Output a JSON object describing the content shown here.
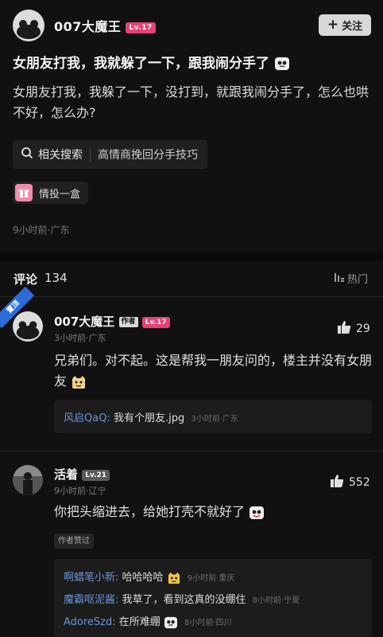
{
  "post": {
    "author": {
      "name": "007大魔王",
      "level": "Lv.17"
    },
    "follow_label": "关注",
    "title": "女朋友打我，我就躲了一下，跟我闹分手了",
    "body": "女朋友打我，我躲了一下，没打到，就跟我闹分手了，怎么也哄不好，怎么办?",
    "related_search": {
      "label": "相关搜索",
      "suggestion": "高情商挽回分手技巧"
    },
    "gift_label": "情投一盒",
    "meta": "9小时前·广东"
  },
  "comments_header": {
    "label": "评论",
    "count": "134",
    "sort_label": "热门"
  },
  "comments": [
    {
      "pinned_label": "置顶",
      "name": "007大魔王",
      "author_tag": "作者",
      "level": "Lv.17",
      "meta": "3小时前·广东",
      "likes": "29",
      "text": "兄弟们。对不起。这是帮我一朋友问的，楼主并没有女朋友",
      "replies": [
        {
          "user": "风启QaQ:",
          "text": "我有个朋友.jpg",
          "time": "3小时前·广东"
        }
      ]
    },
    {
      "name": "活着",
      "level": "Lv.21",
      "meta": "9小时前·辽宁",
      "likes": "552",
      "text": "你把头缩进去，给她打壳不就好了",
      "author_liked": "作者赞过",
      "replies": [
        {
          "user": "啊蜡笔小新:",
          "text": "哈哈哈哈",
          "time": "9小时前·重庆"
        },
        {
          "user": "魔霸呕泥酱:",
          "text": "我草了，看到这真的没绷住",
          "time": "8小时前·宁夏"
        },
        {
          "user": "AdoreSzd:",
          "text": "在所难绷",
          "time": "8小时前·四川"
        }
      ]
    }
  ],
  "colors": {
    "background": "#111111",
    "level_badge": "#e8407a",
    "reply_user": "#6b93d6",
    "pin_badge": "#2c6cd8"
  },
  "icons": [
    "panda-avatar",
    "plus-icon",
    "search-icon",
    "gift-icon",
    "sort-icon",
    "thumbs-up-icon",
    "tear-emoji",
    "cat-emoji"
  ]
}
